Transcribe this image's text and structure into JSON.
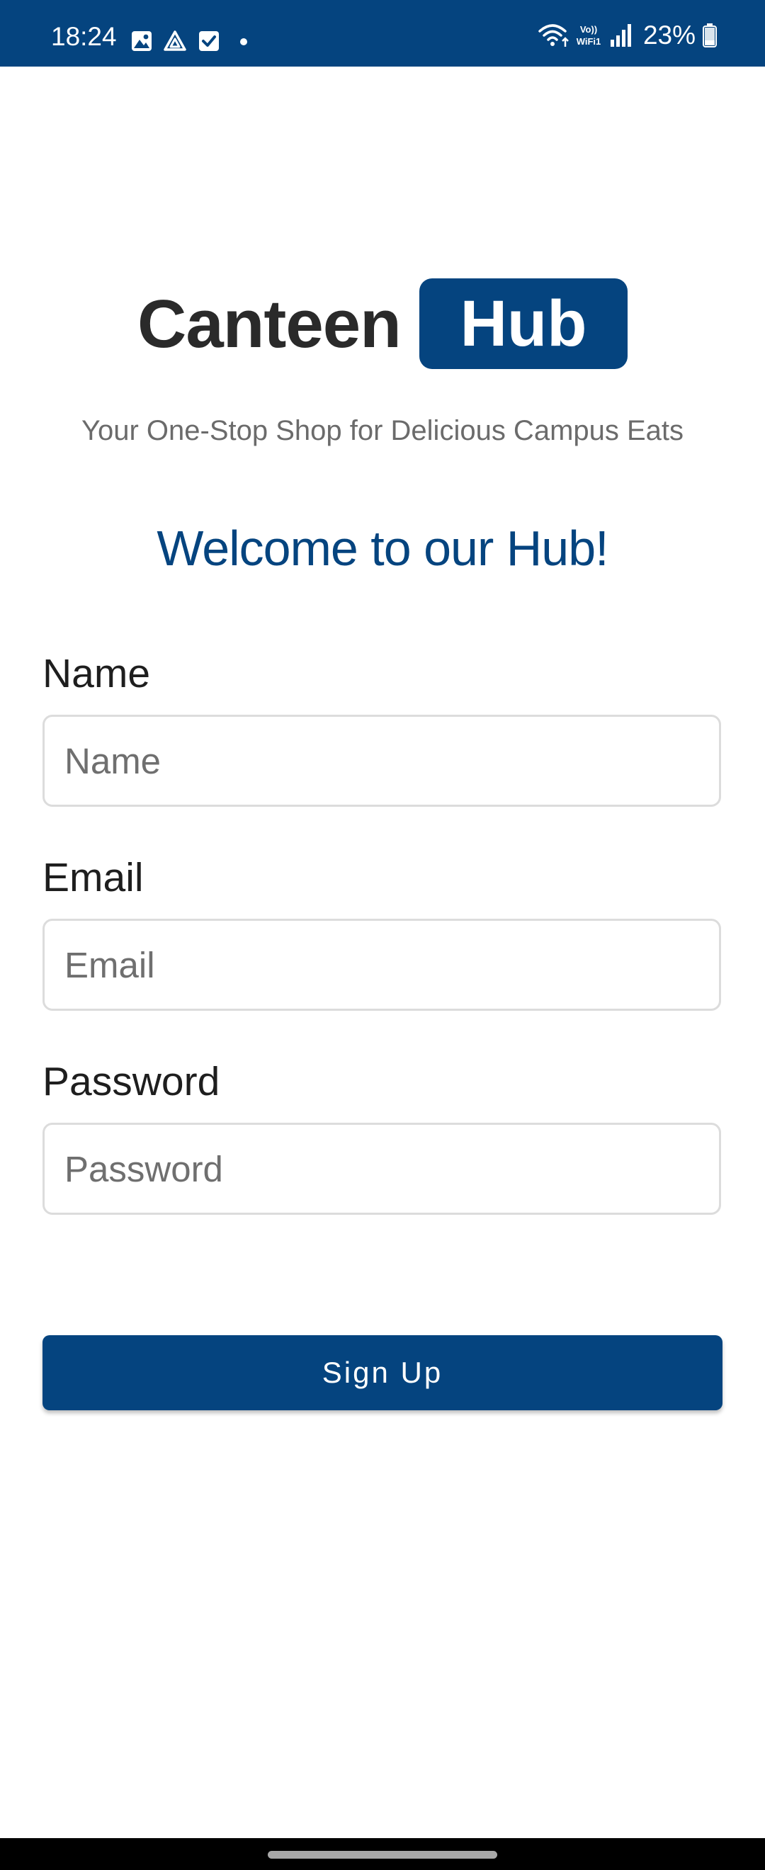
{
  "status_bar": {
    "time": "18:24",
    "battery_text": "23%",
    "left_icons": [
      "gallery-icon",
      "drive-icon",
      "checkbox-icon",
      "notification-dot-icon"
    ],
    "right_icons": [
      "wifi-icon",
      "vowifi-icon",
      "signal-icon",
      "battery-icon"
    ],
    "vowifi_label": "Vo) WiFi1",
    "background": "#05447f"
  },
  "logo": {
    "word": "Canteen",
    "badge_word": "Hub",
    "brand_color": "#05447f"
  },
  "tagline": "Your One-Stop Shop for Delicious Campus Eats",
  "welcome": "Welcome to our Hub!",
  "form": {
    "name": {
      "label": "Name",
      "placeholder": "Name",
      "value": ""
    },
    "email": {
      "label": "Email",
      "placeholder": "Email",
      "value": ""
    },
    "password": {
      "label": "Password",
      "placeholder": "Password",
      "value": ""
    }
  },
  "signup_button": {
    "label": "Sign Up"
  },
  "colors": {
    "accent": "#05447f",
    "label_text": "#1e1e1e",
    "placeholder_text": "#6f6f6f",
    "tagline_text": "#6b6b6b"
  }
}
